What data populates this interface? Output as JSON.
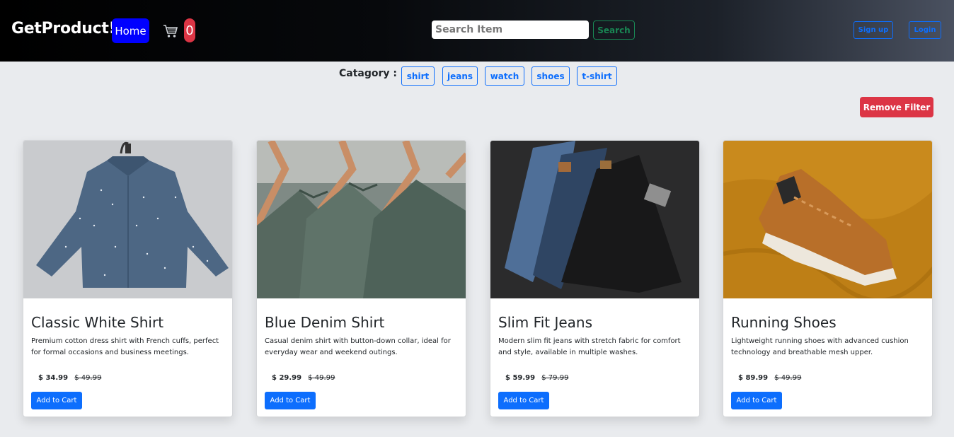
{
  "navbar": {
    "brand": "GetProduct!",
    "home_label": "Home",
    "cart_count": "0",
    "search": {
      "placeholder": "Search Item",
      "button_label": "Search"
    },
    "signup_label": "Sign up",
    "login_label": "Login"
  },
  "categories": {
    "label": "Catagory :",
    "items": [
      "shirt",
      "jeans",
      "watch",
      "shoes",
      "t-shirt"
    ]
  },
  "remove_filter_label": "Remove Filter",
  "products": [
    {
      "title": "Classic White Shirt",
      "description": "Premium cotton dress shirt with French cuffs, perfect for formal occasions and business meetings.",
      "price": "$ 34.99",
      "old_price": "$ 49.99",
      "button": "Add to Cart",
      "image": "denim-shirt-on-hanger"
    },
    {
      "title": "Blue Denim Shirt",
      "description": "Casual denim shirt with button-down collar, ideal for everyday wear and weekend outings.",
      "price": "$ 29.99",
      "old_price": "$ 49.99",
      "button": "Add to Cart",
      "image": "green-shirts-on-hangers"
    },
    {
      "title": "Slim Fit Jeans",
      "description": "Modern slim fit jeans with stretch fabric for comfort and style, available in multiple washes.",
      "price": "$ 59.99",
      "old_price": "$ 79.99",
      "button": "Add to Cart",
      "image": "stacked-jeans"
    },
    {
      "title": "Running Shoes",
      "description": "Lightweight running shoes with advanced cushion technology and breathable mesh upper.",
      "price": "$ 89.99",
      "old_price": "$ 49.99",
      "button": "Add to Cart",
      "image": "brown-sneaker-on-yellow-fabric"
    }
  ],
  "colors": {
    "home_button": "#0000ff",
    "cart_badge": "#dc3545",
    "primary": "#0d6efd",
    "success": "#198754",
    "danger": "#dc3545",
    "page_background": "#e9ebee"
  }
}
